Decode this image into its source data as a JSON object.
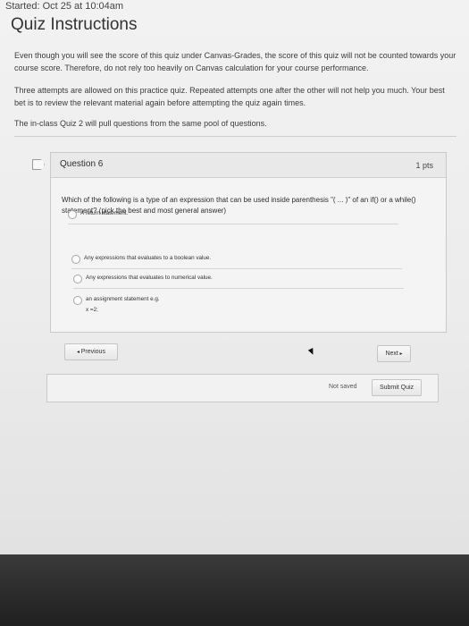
{
  "started": "Started: Oct 25 at 10:04am",
  "title": "Quiz Instructions",
  "instructions": [
    "Even though you will see the score of this quiz under Canvas-Grades, the score of this quiz will not be counted towards your course score. Therefore, do not rely too heavily on Canvas calculation for your course performance.",
    "Three attempts are allowed on this practice quiz. Repeated attempts one after the other will not help you much. Your best bet is to review the relevant material again before attempting the quiz again times.",
    "The in-class Quiz 2 will pull questions from the same pool of questions."
  ],
  "question": {
    "title": "Question 6",
    "points": "1 pts",
    "text": "Which of the following is a type of an expression that can be used inside parenthesis \"( ... )\" of an if() or a while() statement? (pick the best and most general answer)",
    "answers": [
      "A return statement.",
      "Any expressions that evaluates to a boolean value.",
      "Any expressions that evaluates to numerical value.",
      "an assignment statement e.g."
    ],
    "answer_example": "x =2;"
  },
  "nav": {
    "previous": "Previous",
    "next": "Next"
  },
  "footer": {
    "status": "Not saved",
    "submit": "Submit Quiz"
  }
}
